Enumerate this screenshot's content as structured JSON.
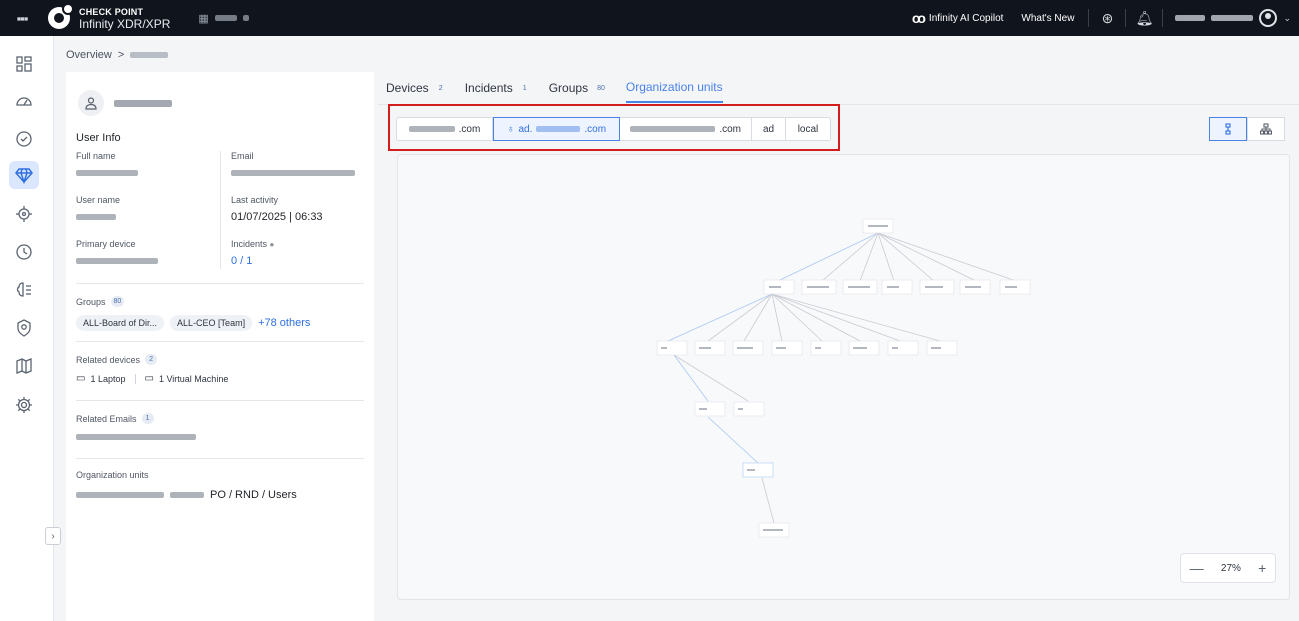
{
  "topbar": {
    "brand_top": "CHECK POINT",
    "brand_sub": "Infinity XDR/XPR",
    "copilot_label": "Infinity AI Copilot",
    "whats_new": "What's New"
  },
  "breadcrumb": {
    "root": "Overview",
    "separator": ">"
  },
  "user": {
    "section_title": "User Info",
    "fields": {
      "full_name_label": "Full name",
      "email_label": "Email",
      "user_name_label": "User name",
      "last_activity_label": "Last activity",
      "last_activity_value": "01/07/2025 | 06:33",
      "primary_device_label": "Primary device",
      "incidents_label": "Incidents",
      "incidents_value": "0 / 1"
    },
    "groups": {
      "label": "Groups",
      "count": "80",
      "chips": [
        "ALL-Board of Dir...",
        "ALL-CEO [Team]"
      ],
      "more": "+78 others"
    },
    "related_devices": {
      "label": "Related devices",
      "count": "2",
      "laptop": "1 Laptop",
      "vm": "1 Virtual Machine"
    },
    "related_emails": {
      "label": "Related Emails",
      "count": "1"
    },
    "org_units": {
      "label": "Organization units",
      "path_suffix": "PO / RND / Users"
    }
  },
  "tabs": [
    {
      "label": "Devices",
      "count": "2"
    },
    {
      "label": "Incidents",
      "count": "1"
    },
    {
      "label": "Groups",
      "count": "80"
    },
    {
      "label": "Organization units",
      "count": ""
    }
  ],
  "domains": [
    {
      "suffix": ".com",
      "active": false
    },
    {
      "suffix": "ad.",
      "suffix2": ".com",
      "active": true
    },
    {
      "suffix": ".com",
      "active": false
    },
    {
      "suffix": "ad",
      "active": false
    },
    {
      "suffix": "local",
      "active": false
    }
  ],
  "zoom": {
    "level": "27%",
    "minus": "—",
    "plus": "+"
  },
  "colors": {
    "accent": "#4a82e8",
    "highlight_border": "#d51c1c",
    "topbar": "#10141c"
  }
}
